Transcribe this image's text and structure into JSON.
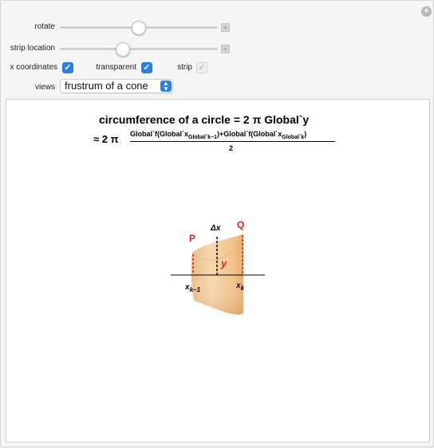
{
  "controls": {
    "rotate_label": "rotate",
    "rotate_value": 0.54,
    "strip_location_label": "strip location",
    "strip_location_value": 0.4,
    "x_coordinates_label": "x coordinates",
    "x_coordinates_checked": true,
    "transparent_label": "transparent",
    "transparent_checked": true,
    "strip_label": "strip",
    "strip_checked": true,
    "strip_enabled": false,
    "views_label": "views",
    "views_selected": "frustrum of a cone"
  },
  "equation": {
    "line1": "circumference of a circle = 2 π Global`y",
    "line2_prefix": "≈ 2 π",
    "num_part1": "Global`f(Global`x",
    "num_sub1": "Global`k−1",
    "num_part2": ")+Global`f(Global`x",
    "num_sub2": "Global`k",
    "num_part3": ")",
    "denominator": "2"
  },
  "figure": {
    "label_P": "P",
    "label_Q": "Q",
    "label_dx": "Δx",
    "label_y": "y",
    "label_xk1": "x",
    "label_xk1_sub": "k−1",
    "label_xk": "x",
    "label_xk_sub": "k",
    "surface_color": "#f0b87a",
    "accent_red": "#e0201b"
  }
}
